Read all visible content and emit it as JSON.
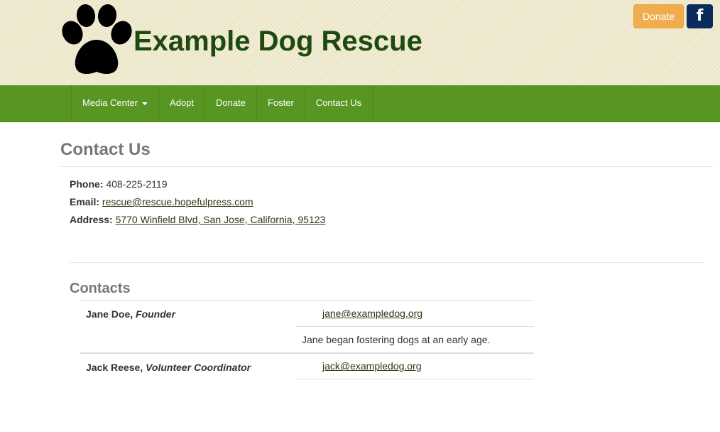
{
  "header": {
    "site_title": "Example Dog Rescue",
    "donate_label": "Donate",
    "facebook_glyph": "f",
    "logo_icon": "paw-print-icon",
    "colors": {
      "title": "#1e4a0f",
      "donate": "#f0ad4e",
      "facebook": "#0b2b5c"
    }
  },
  "nav": {
    "background": "#579622",
    "items": [
      {
        "label": "Media Center",
        "has_dropdown": true
      },
      {
        "label": "Adopt"
      },
      {
        "label": "Donate"
      },
      {
        "label": "Foster"
      },
      {
        "label": "Contact Us"
      }
    ]
  },
  "page": {
    "title": "Contact Us",
    "phone_label": "Phone:",
    "phone_value": "408-225-2119",
    "email_label": "Email:",
    "email_value": "rescue@rescue.hopefulpress.com",
    "address_label": "Address:",
    "address_value": "5770 Winfield Blvd, San Jose, California, 95123"
  },
  "contacts": {
    "title": "Contacts",
    "people": [
      {
        "name": "Jane Doe,",
        "role": "Founder",
        "email": "jane@exampledog.org",
        "bio": "Jane began fostering dogs at an early age."
      },
      {
        "name": "Jack Reese,",
        "role": "Volunteer Coordinator",
        "email": "jack@exampledog.org"
      }
    ]
  }
}
